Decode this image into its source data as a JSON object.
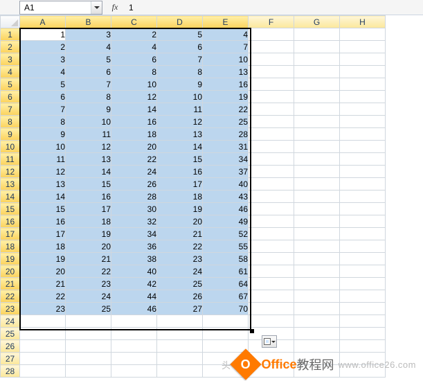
{
  "formula_bar": {
    "cell_ref": "A1",
    "fx_label": "fx",
    "value": "1"
  },
  "columns": [
    "A",
    "B",
    "C",
    "D",
    "E",
    "F",
    "G",
    "H"
  ],
  "selection": {
    "rows": 23,
    "cols": 5,
    "active_row": 1,
    "active_col": 1
  },
  "row_count": 28,
  "chart_data": {
    "type": "table",
    "columns": [
      "A",
      "B",
      "C",
      "D",
      "E"
    ],
    "rows": [
      [
        1,
        3,
        2,
        5,
        4
      ],
      [
        2,
        4,
        4,
        6,
        7
      ],
      [
        3,
        5,
        6,
        7,
        10
      ],
      [
        4,
        6,
        8,
        8,
        13
      ],
      [
        5,
        7,
        10,
        9,
        16
      ],
      [
        6,
        8,
        12,
        10,
        19
      ],
      [
        7,
        9,
        14,
        11,
        22
      ],
      [
        8,
        10,
        16,
        12,
        25
      ],
      [
        9,
        11,
        18,
        13,
        28
      ],
      [
        10,
        12,
        20,
        14,
        31
      ],
      [
        11,
        13,
        22,
        15,
        34
      ],
      [
        12,
        14,
        24,
        16,
        37
      ],
      [
        13,
        15,
        26,
        17,
        40
      ],
      [
        14,
        16,
        28,
        18,
        43
      ],
      [
        15,
        17,
        30,
        19,
        46
      ],
      [
        16,
        18,
        32,
        20,
        49
      ],
      [
        17,
        19,
        34,
        21,
        52
      ],
      [
        18,
        20,
        36,
        22,
        55
      ],
      [
        19,
        21,
        38,
        23,
        58
      ],
      [
        20,
        22,
        40,
        24,
        61
      ],
      [
        21,
        23,
        42,
        25,
        64
      ],
      [
        22,
        24,
        44,
        26,
        67
      ],
      [
        23,
        25,
        46,
        27,
        70
      ]
    ]
  },
  "watermark": {
    "brand_letter": "O",
    "brand1": "Office",
    "brand2": "教程网",
    "url_prefix": "头",
    "url": "www.office26.com"
  }
}
